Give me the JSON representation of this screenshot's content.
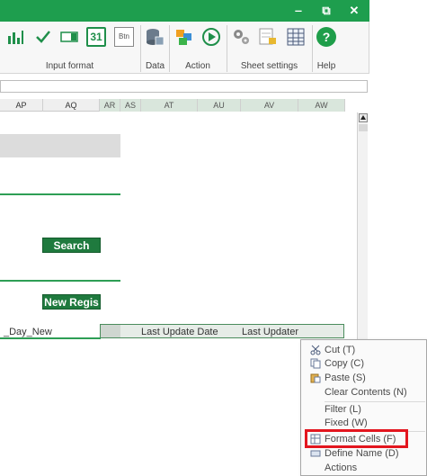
{
  "window": {
    "minimize_glyph": "‒",
    "restore_glyph": "⧉",
    "close_glyph": "✕",
    "title_bar_color": "#1e9e4e"
  },
  "ribbon": {
    "groups": [
      {
        "label": "Input format"
      },
      {
        "label": "Data"
      },
      {
        "label": "Action"
      },
      {
        "label": "Sheet settings"
      },
      {
        "label": "Help"
      }
    ],
    "icons": {
      "calendar_text": "31",
      "button_text": "Btn",
      "help_text": "?"
    }
  },
  "columns": [
    "AP",
    "AQ",
    "AR",
    "AS",
    "AT",
    "AU",
    "AV",
    "AW"
  ],
  "sheet": {
    "search_button": "Search",
    "new_button": "New Regis",
    "left_cell_text": "_Day_New",
    "header_row": [
      "Last Update Date",
      "Last Updater"
    ]
  },
  "context_menu": {
    "items": [
      {
        "label": "Cut (T)",
        "icon": "scissors-icon"
      },
      {
        "label": "Copy (C)",
        "icon": "copy-icon"
      },
      {
        "label": "Paste (S)",
        "icon": "paste-icon"
      },
      {
        "label": "Clear Contents (N)",
        "icon": ""
      },
      {
        "label": "Filter (L)",
        "icon": ""
      },
      {
        "label": "Fixed (W)",
        "icon": ""
      },
      {
        "label": "Format Cells (F)",
        "icon": "format-cells-icon"
      },
      {
        "label": "Define Name (D)",
        "icon": "define-name-icon"
      },
      {
        "label": "Actions",
        "icon": ""
      }
    ],
    "highlight_color": "#e3161f"
  }
}
